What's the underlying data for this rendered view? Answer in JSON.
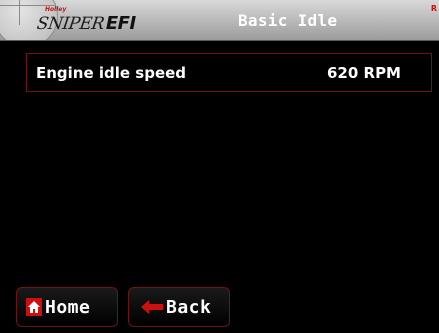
{
  "header": {
    "brand_top": "Holley",
    "brand_sniper": "SNIPER",
    "brand_efi": "EFI",
    "title": "Basic Idle",
    "corner_mark": "R"
  },
  "setting": {
    "label": "Engine idle speed",
    "value": "620 RPM"
  },
  "buttons": {
    "home_label": "Home",
    "back_label": "Back",
    "home_icon": "home-icon",
    "back_icon": "left-arrow-icon"
  },
  "colors": {
    "accent": "#cc1010",
    "border": "#6e1414",
    "background": "#000000",
    "text": "#ffffff"
  }
}
